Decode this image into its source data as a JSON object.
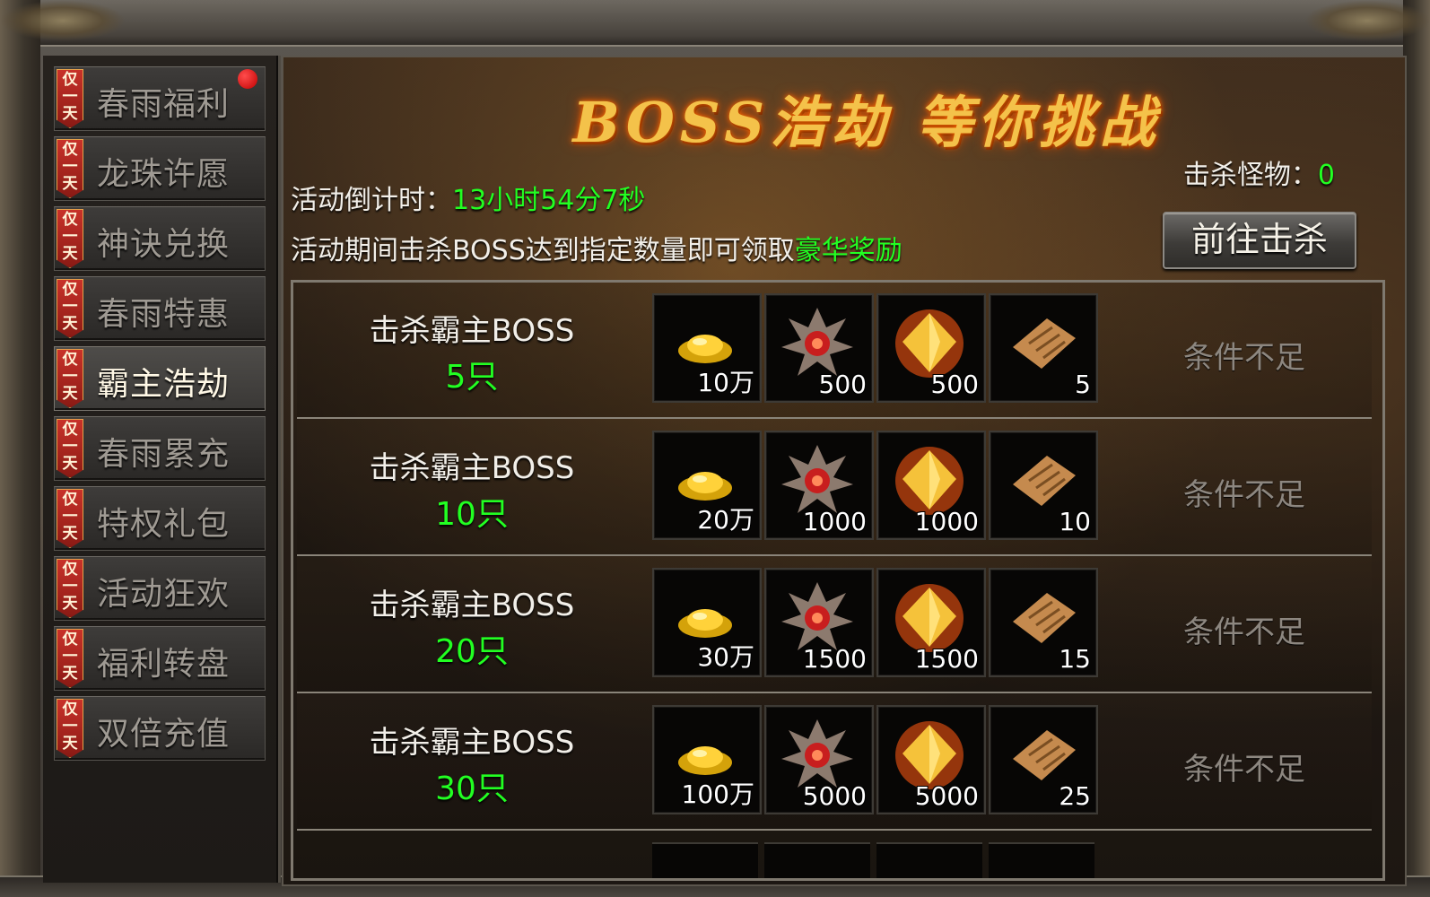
{
  "sidebar": {
    "badge_chars": [
      "仅",
      "一",
      "天"
    ],
    "items": [
      {
        "label": "春雨福利",
        "has_dot": true
      },
      {
        "label": "龙珠许愿"
      },
      {
        "label": "神诀兑换"
      },
      {
        "label": "春雨特惠"
      },
      {
        "label": "霸主浩劫",
        "active": true
      },
      {
        "label": "春雨累充"
      },
      {
        "label": "特权礼包"
      },
      {
        "label": "活动狂欢"
      },
      {
        "label": "福利转盘"
      },
      {
        "label": "双倍充值"
      }
    ]
  },
  "header": {
    "title": "BOSS浩劫  等你挑战"
  },
  "countdown": {
    "label": "活动倒计时：",
    "value": "13小时54分7秒"
  },
  "description": {
    "text": "活动期间击杀BOSS达到指定数量即可领取",
    "highlight": "豪华奖励"
  },
  "kills": {
    "label": "击杀怪物：",
    "value": "0"
  },
  "go_button": {
    "label": "前往击杀"
  },
  "colors": {
    "accent_green": "#22ff22",
    "title_gold": "#f4c24a",
    "status_gray": "#8d8780"
  },
  "rewards": [
    {
      "title": "击杀霸主BOSS",
      "count": "5只",
      "items": [
        {
          "icon": "gold-ingot-icon",
          "qty": "10万"
        },
        {
          "icon": "demon-emblem-icon",
          "qty": "500"
        },
        {
          "icon": "fire-crystal-icon",
          "qty": "500"
        },
        {
          "icon": "scroll-icon",
          "qty": "5"
        }
      ],
      "status": "条件不足"
    },
    {
      "title": "击杀霸主BOSS",
      "count": "10只",
      "items": [
        {
          "icon": "gold-ingot-icon",
          "qty": "20万"
        },
        {
          "icon": "demon-emblem-icon",
          "qty": "1000"
        },
        {
          "icon": "fire-crystal-icon",
          "qty": "1000"
        },
        {
          "icon": "scroll-icon",
          "qty": "10"
        }
      ],
      "status": "条件不足"
    },
    {
      "title": "击杀霸主BOSS",
      "count": "20只",
      "items": [
        {
          "icon": "gold-ingot-icon",
          "qty": "30万"
        },
        {
          "icon": "demon-emblem-icon",
          "qty": "1500"
        },
        {
          "icon": "fire-crystal-icon",
          "qty": "1500"
        },
        {
          "icon": "scroll-icon",
          "qty": "15"
        }
      ],
      "status": "条件不足"
    },
    {
      "title": "击杀霸主BOSS",
      "count": "30只",
      "items": [
        {
          "icon": "gold-ingot-icon",
          "qty": "100万"
        },
        {
          "icon": "demon-emblem-icon",
          "qty": "5000"
        },
        {
          "icon": "fire-crystal-icon",
          "qty": "5000"
        },
        {
          "icon": "scroll-icon",
          "qty": "25"
        }
      ],
      "status": "条件不足"
    }
  ]
}
